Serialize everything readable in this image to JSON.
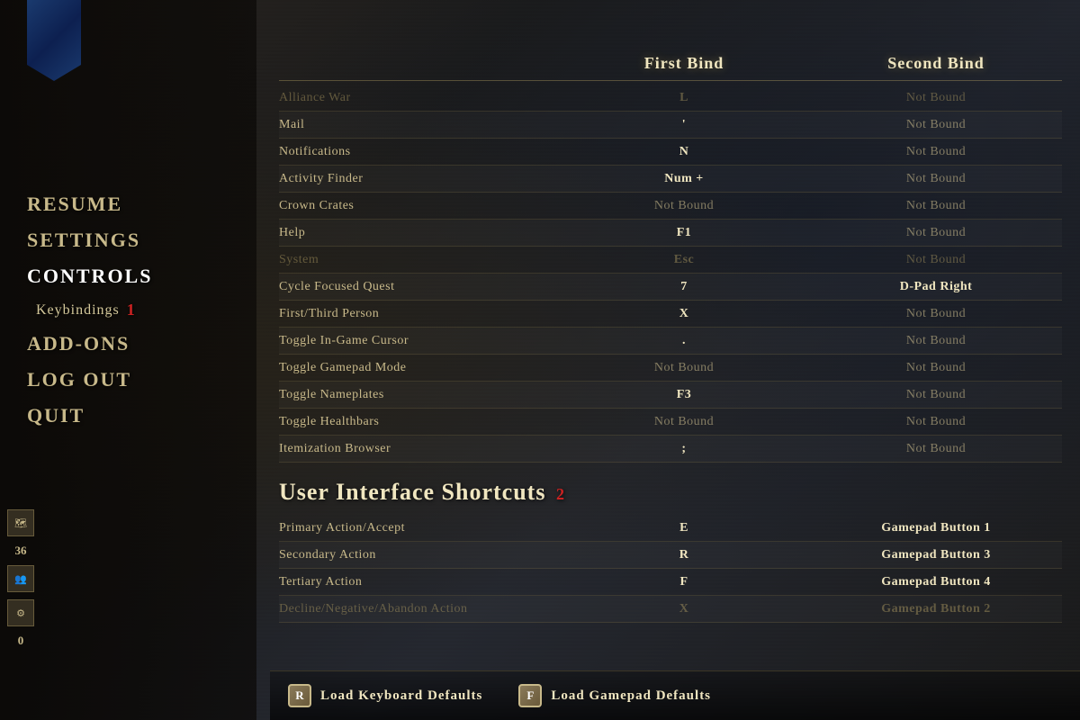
{
  "background": {
    "color": "#1e1e1e"
  },
  "nav": {
    "items": [
      {
        "id": "resume",
        "label": "RESUME",
        "active": false
      },
      {
        "id": "settings",
        "label": "SETTINGS",
        "active": false
      },
      {
        "id": "controls",
        "label": "CONTROLS",
        "active": true
      },
      {
        "id": "keybindings",
        "label": "Keybindings",
        "sub": true
      },
      {
        "id": "addons",
        "label": "ADD-ONS",
        "active": false
      },
      {
        "id": "logout",
        "label": "LOG OUT",
        "active": false
      },
      {
        "id": "quit",
        "label": "QUIT",
        "active": false
      }
    ],
    "badge1": "1"
  },
  "header": {
    "first_bind": "First Bind",
    "second_bind": "Second Bind"
  },
  "keybindings_section": {
    "rows": [
      {
        "action": "Alliance War",
        "first": "L",
        "second": "Not Bound",
        "dimmed": true
      },
      {
        "action": "Mail",
        "first": "'",
        "second": "Not Bound",
        "dimmed": false
      },
      {
        "action": "Notifications",
        "first": "N",
        "second": "Not Bound",
        "dimmed": false
      },
      {
        "action": "Activity Finder",
        "first": "Num +",
        "second": "Not Bound",
        "dimmed": false
      },
      {
        "action": "Crown Crates",
        "first": "Not Bound",
        "second": "Not Bound",
        "dimmed": false
      },
      {
        "action": "Help",
        "first": "F1",
        "second": "Not Bound",
        "dimmed": false
      },
      {
        "action": "System",
        "first": "Esc",
        "second": "Not Bound",
        "dimmed": true
      },
      {
        "action": "Cycle Focused Quest",
        "first": "7",
        "second": "D-Pad Right",
        "dimmed": false
      },
      {
        "action": "First/Third Person",
        "first": "X",
        "second": "Not Bound",
        "dimmed": false
      },
      {
        "action": "Toggle In-Game Cursor",
        "first": ".",
        "second": "Not Bound",
        "dimmed": false
      },
      {
        "action": "Toggle Gamepad Mode",
        "first": "Not Bound",
        "second": "Not Bound",
        "dimmed": false
      },
      {
        "action": "Toggle Nameplates",
        "first": "F3",
        "second": "Not Bound",
        "dimmed": false
      },
      {
        "action": "Toggle Healthbars",
        "first": "Not Bound",
        "second": "Not Bound",
        "dimmed": false
      },
      {
        "action": "Itemization Browser",
        "first": ";",
        "second": "Not Bound",
        "dimmed": false
      }
    ]
  },
  "ui_shortcuts_section": {
    "title": "User Interface Shortcuts",
    "badge2": "2",
    "rows": [
      {
        "action": "Primary Action/Accept",
        "first": "E",
        "second": "Gamepad Button 1",
        "dimmed": false
      },
      {
        "action": "Secondary Action",
        "first": "R",
        "second": "Gamepad Button 3",
        "dimmed": false
      },
      {
        "action": "Tertiary Action",
        "first": "F",
        "second": "Gamepad Button 4",
        "dimmed": false
      },
      {
        "action": "Decline/Negative/Abandon Action",
        "first": "X",
        "second": "Gamepad Button 2",
        "dimmed": true
      }
    ]
  },
  "bottom_bar": {
    "btn1_key": "R",
    "btn1_label": "Load Keyboard Defaults",
    "btn2_key": "F",
    "btn2_label": "Load Gamepad Defaults"
  },
  "bottom_icons": [
    {
      "icon": "🗺",
      "label": "36"
    },
    {
      "icon": "👥",
      "label": ""
    },
    {
      "icon": "",
      "label": "0"
    }
  ]
}
